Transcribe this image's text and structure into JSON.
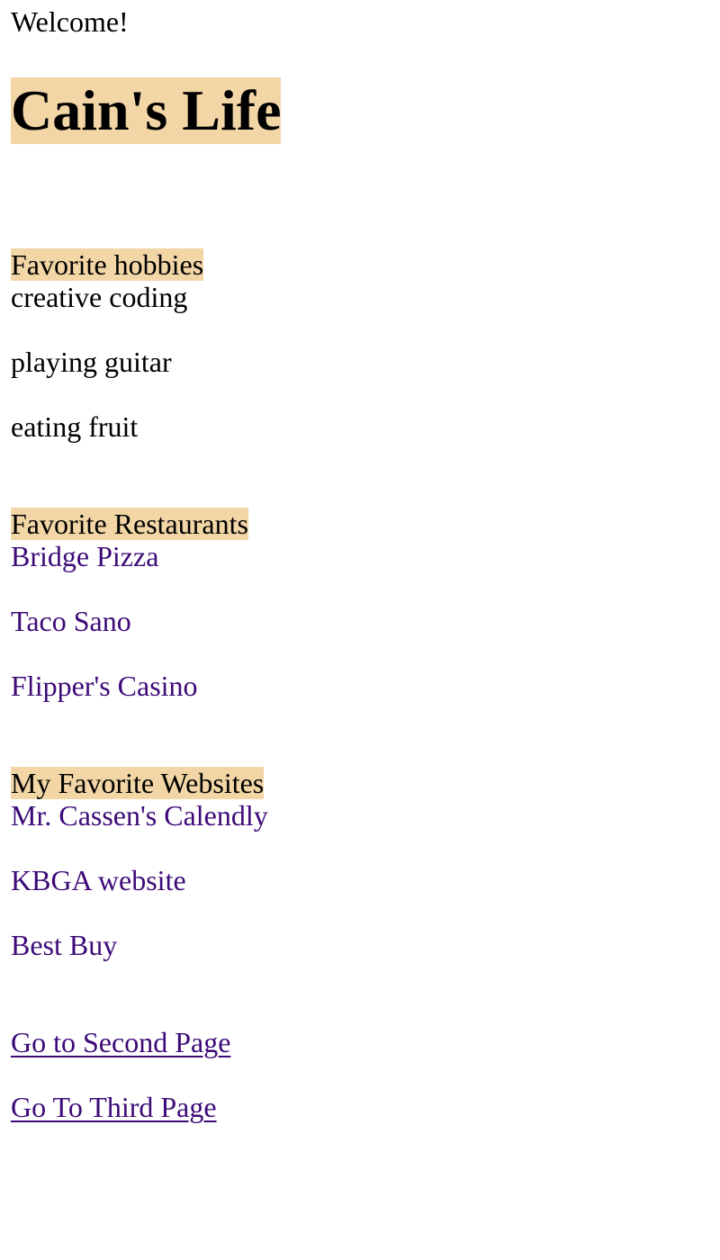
{
  "welcome": "Welcome!",
  "title": "Cain's Life",
  "highlight_color": "#f2d6a6",
  "link_color": "#3d0b78",
  "hobbies": {
    "heading": "Favorite hobbies",
    "items": [
      "creative coding",
      "playing guitar",
      "eating fruit"
    ]
  },
  "restaurants": {
    "heading": "Favorite Restaurants",
    "items": [
      "Bridge Pizza",
      "Taco Sano",
      "Flipper's Casino"
    ]
  },
  "websites": {
    "heading": "My Favorite Websites",
    "items": [
      "Mr. Cassen's Calendly",
      "KBGA website",
      "Best Buy"
    ]
  },
  "nav": {
    "second_page": "Go to Second Page",
    "third_page": "Go To Third Page"
  }
}
